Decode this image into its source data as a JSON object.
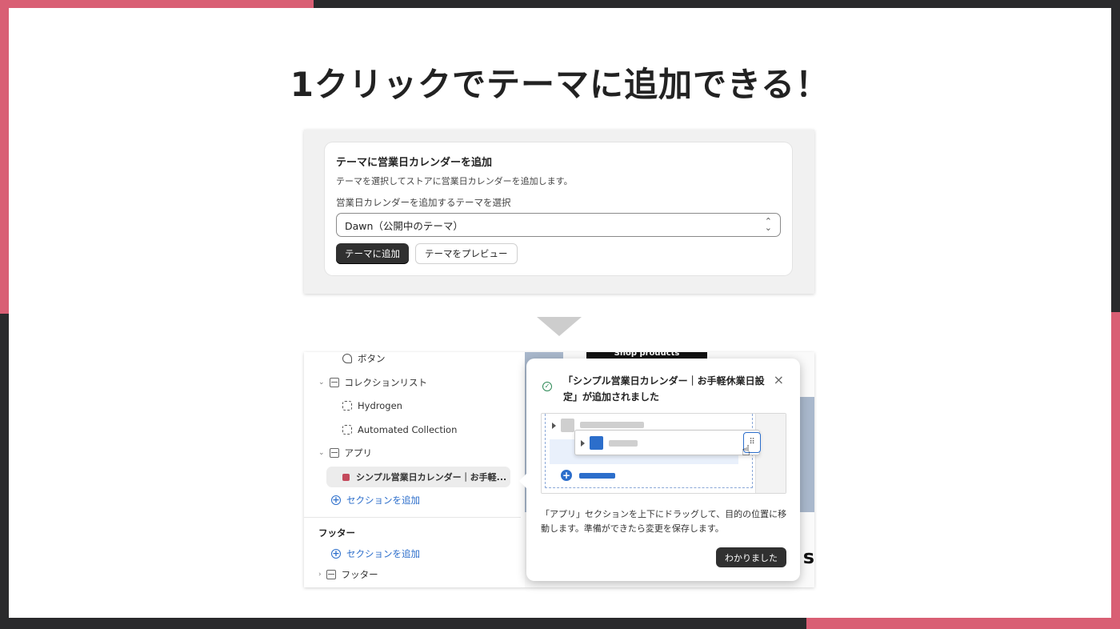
{
  "headline": "1クリックでテーマに追加できる！",
  "top_card": {
    "title": "テーマに営業日カレンダーを追加",
    "description": "テーマを選択してストアに営業日カレンダーを追加します。",
    "select_label": "営業日カレンダーを追加するテーマを選択",
    "select_value": "Dawn（公開中のテーマ）",
    "add_button": "テーマに追加",
    "preview_button": "テーマをプレビュー"
  },
  "sidebar": {
    "button_item": "ボタン",
    "collection_list": "コレクションリスト",
    "collection_1": "Hydrogen",
    "collection_2": "Automated Collection",
    "app_section": "アプリ",
    "app_block": "シンプル営業日カレンダー｜お手軽...",
    "add_section_1": "セクションを追加",
    "footer_heading": "フッター",
    "add_section_2": "セクションを追加",
    "footer_item": "フッター"
  },
  "preview": {
    "shop_button": "Shop products",
    "partial_letter": "s"
  },
  "popover": {
    "title": "「シンプル営業日カレンダー｜お手軽休業日設定」が追加されました",
    "body": "「アプリ」セクションを上下にドラッグして、目的の位置に移動します。準備ができたら変更を保存します。",
    "button": "わかりました"
  },
  "colors": {
    "accent": "#d95f74",
    "frame": "#2a2a2c",
    "primary_button": "#303030",
    "link": "#2c6ecb",
    "success": "#2e8a57"
  }
}
